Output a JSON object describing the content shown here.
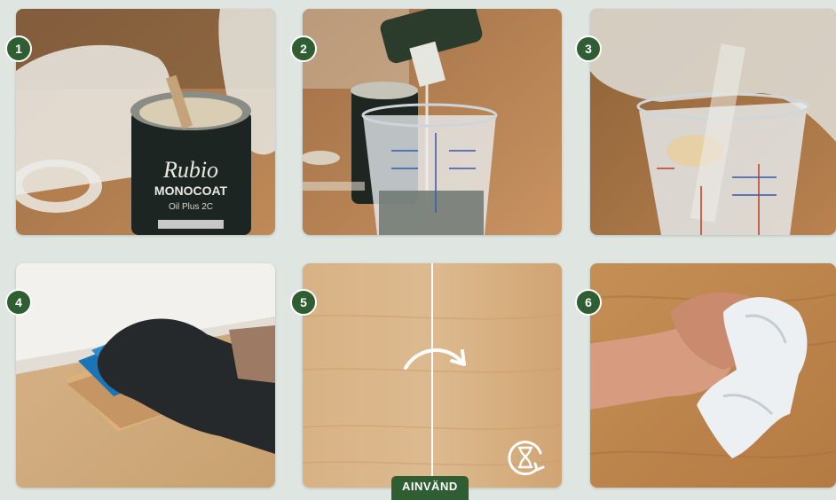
{
  "steps": [
    {
      "number": "1"
    },
    {
      "number": "2"
    },
    {
      "number": "3"
    },
    {
      "number": "4"
    },
    {
      "number": "5"
    },
    {
      "number": "6"
    }
  ],
  "can": {
    "brand": "Rubio",
    "name": "MONOCOAT",
    "product": "Oil Plus 2C"
  },
  "step5_tag": "AINVÄND",
  "icons": {
    "step5_arrow": "curved-arrow-icon",
    "step5_timer": "hourglass-rotate-icon"
  },
  "colors": {
    "badge": "#2f5e33",
    "background": "#dfe6e1",
    "wood": "#c8955a"
  }
}
